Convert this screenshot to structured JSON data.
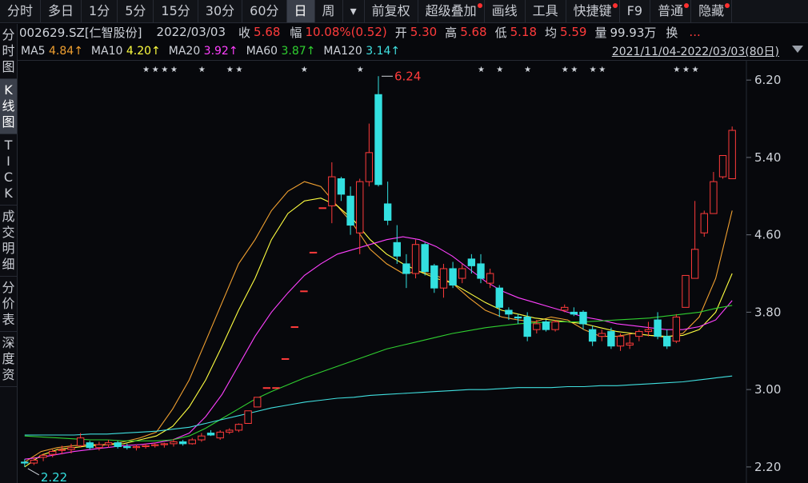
{
  "toolbar": {
    "items": [
      "分时",
      "多日",
      "1分",
      "5分",
      "15分",
      "30分",
      "60分",
      "日",
      "周",
      "▾",
      "前复权",
      "超级叠加",
      "画线",
      "工具",
      "快捷键",
      "F9",
      "普通",
      "隐藏"
    ],
    "active_index": 7,
    "dot_indices": [
      11,
      14,
      16,
      17
    ]
  },
  "sidebar": {
    "items": [
      "分时图",
      "K线图",
      "TICK",
      "成交明细",
      "分价表",
      "深度资"
    ],
    "active_index": 1
  },
  "quote": {
    "code": "002629.SZ[仁智股份]",
    "date": "2022/03/03",
    "close_label": "收",
    "close": "5.68",
    "change_label": "幅",
    "change": "10.08%(0.52)",
    "open_label": "开",
    "open": "5.30",
    "high_label": "高",
    "high": "5.68",
    "low_label": "低",
    "low": "5.18",
    "avg_label": "均",
    "avg": "5.59",
    "vol_label": "量",
    "vol": "99.93万",
    "turn_label": "换",
    "more": "..."
  },
  "ma_bar": [
    {
      "name": "MA5",
      "value": "4.84↑",
      "color": "#f0a030"
    },
    {
      "name": "MA10",
      "value": "4.20↑",
      "color": "#ffff40"
    },
    {
      "name": "MA20",
      "value": "3.92↑",
      "color": "#ff40ff"
    },
    {
      "name": "MA60",
      "value": "3.87↑",
      "color": "#30d030"
    },
    {
      "name": "MA120",
      "value": "3.14↑",
      "color": "#40e0e0"
    }
  ],
  "range_label": "2021/11/04-2022/03/03(80日)",
  "chart_data": {
    "type": "candlestick",
    "y_ticks": [
      "6.20",
      "5.40",
      "4.60",
      "3.80",
      "3.00",
      "2.20"
    ],
    "ylim": [
      2.1,
      6.35
    ],
    "annotations": {
      "high_value": "6.24",
      "low_value": "2.22"
    },
    "candles": [
      [
        2.25,
        2.28,
        2.2,
        2.24
      ],
      [
        2.24,
        2.3,
        2.22,
        2.27
      ],
      [
        2.3,
        2.34,
        2.26,
        2.32
      ],
      [
        2.33,
        2.38,
        2.3,
        2.36
      ],
      [
        2.37,
        2.42,
        2.33,
        2.38
      ],
      [
        2.38,
        2.44,
        2.34,
        2.4
      ],
      [
        2.42,
        2.55,
        2.4,
        2.5
      ],
      [
        2.45,
        2.47,
        2.38,
        2.4
      ],
      [
        2.4,
        2.46,
        2.37,
        2.43
      ],
      [
        2.43,
        2.48,
        2.4,
        2.45
      ],
      [
        2.45,
        2.47,
        2.39,
        2.41
      ],
      [
        2.41,
        2.44,
        2.38,
        2.4
      ],
      [
        2.4,
        2.43,
        2.37,
        2.41
      ],
      [
        2.41,
        2.44,
        2.39,
        2.42
      ],
      [
        2.42,
        2.45,
        2.4,
        2.43
      ],
      [
        2.43,
        2.45,
        2.4,
        2.44
      ],
      [
        2.44,
        2.49,
        2.41,
        2.46
      ],
      [
        2.46,
        2.48,
        2.42,
        2.44
      ],
      [
        2.44,
        2.5,
        2.43,
        2.48
      ],
      [
        2.48,
        2.55,
        2.46,
        2.52
      ],
      [
        2.55,
        2.58,
        2.52,
        2.53
      ],
      [
        2.5,
        2.58,
        2.48,
        2.56
      ],
      [
        2.56,
        2.6,
        2.54,
        2.58
      ],
      [
        2.58,
        2.65,
        2.56,
        2.64
      ],
      [
        2.65,
        2.78,
        2.65,
        2.78
      ],
      [
        2.82,
        2.92,
        2.82,
        2.92
      ],
      [
        3.02,
        3.02,
        3.02,
        3.02
      ],
      [
        3.02,
        3.02,
        3.02,
        3.02
      ],
      [
        3.32,
        3.32,
        3.32,
        3.32
      ],
      [
        3.65,
        3.65,
        3.65,
        3.65
      ],
      [
        4.02,
        4.02,
        4.02,
        4.02
      ],
      [
        4.42,
        4.42,
        4.42,
        4.42
      ],
      [
        4.88,
        4.88,
        4.88,
        4.88
      ],
      [
        4.9,
        5.35,
        4.72,
        5.2
      ],
      [
        5.18,
        5.2,
        4.95,
        5.02
      ],
      [
        5.0,
        5.1,
        4.6,
        4.7
      ],
      [
        4.62,
        5.18,
        4.4,
        5.15
      ],
      [
        5.15,
        5.75,
        5.1,
        5.45
      ],
      [
        6.05,
        6.24,
        5.1,
        5.12
      ],
      [
        4.92,
        5.15,
        4.7,
        4.75
      ],
      [
        4.52,
        4.7,
        4.3,
        4.38
      ],
      [
        4.3,
        4.4,
        4.05,
        4.2
      ],
      [
        4.2,
        4.55,
        4.15,
        4.5
      ],
      [
        4.5,
        4.52,
        4.18,
        4.22
      ],
      [
        4.28,
        4.3,
        4.0,
        4.05
      ],
      [
        4.05,
        4.3,
        3.95,
        4.25
      ],
      [
        4.25,
        4.32,
        4.05,
        4.08
      ],
      [
        4.15,
        4.3,
        4.1,
        4.25
      ],
      [
        4.35,
        4.4,
        4.2,
        4.28
      ],
      [
        4.3,
        4.4,
        4.1,
        4.15
      ],
      [
        4.1,
        4.25,
        4.05,
        4.2
      ],
      [
        4.05,
        4.08,
        3.75,
        3.85
      ],
      [
        3.82,
        3.85,
        3.72,
        3.78
      ],
      [
        3.75,
        3.78,
        3.68,
        3.74
      ],
      [
        3.75,
        3.8,
        3.5,
        3.55
      ],
      [
        3.62,
        3.72,
        3.58,
        3.68
      ],
      [
        3.7,
        3.72,
        3.6,
        3.62
      ],
      [
        3.62,
        3.72,
        3.6,
        3.7
      ],
      [
        3.82,
        3.88,
        3.8,
        3.85
      ],
      [
        3.8,
        3.85,
        3.76,
        3.78
      ],
      [
        3.8,
        3.82,
        3.62,
        3.68
      ],
      [
        3.62,
        3.66,
        3.45,
        3.5
      ],
      [
        3.55,
        3.62,
        3.5,
        3.58
      ],
      [
        3.6,
        3.64,
        3.42,
        3.45
      ],
      [
        3.45,
        3.58,
        3.4,
        3.55
      ],
      [
        3.46,
        3.58,
        3.42,
        3.48
      ],
      [
        3.55,
        3.62,
        3.5,
        3.6
      ],
      [
        3.6,
        3.7,
        3.55,
        3.62
      ],
      [
        3.72,
        3.8,
        3.52,
        3.55
      ],
      [
        3.55,
        3.62,
        3.42,
        3.45
      ],
      [
        3.5,
        3.78,
        3.48,
        3.75
      ],
      [
        3.85,
        4.18,
        3.85,
        4.18
      ],
      [
        4.15,
        4.95,
        4.15,
        4.45
      ],
      [
        4.62,
        4.85,
        4.58,
        4.82
      ],
      [
        4.82,
        5.25,
        4.82,
        5.15
      ],
      [
        5.2,
        5.42,
        5.18,
        5.42
      ],
      [
        5.18,
        5.72,
        5.18,
        5.68
      ]
    ],
    "ma": {
      "MA5": [
        [
          2.25,
          2.36
        ],
        [
          2.4,
          2.42
        ],
        [
          2.43,
          2.43
        ],
        [
          2.46,
          2.5
        ],
        [
          2.56,
          2.8
        ],
        [
          3.1,
          3.5
        ],
        [
          3.9,
          4.3
        ],
        [
          4.55,
          4.85
        ],
        [
          5.05,
          5.15
        ],
        [
          5.1,
          4.9
        ],
        [
          4.7,
          4.45
        ],
        [
          4.3,
          4.2
        ],
        [
          4.22,
          4.18
        ],
        [
          4.1,
          3.95
        ],
        [
          3.82,
          3.75
        ],
        [
          3.72,
          3.7
        ],
        [
          3.75,
          3.72
        ],
        [
          3.62,
          3.55
        ],
        [
          3.55,
          3.58
        ],
        [
          3.56,
          3.54
        ],
        [
          3.58,
          3.75
        ],
        [
          4.15,
          4.85
        ]
      ],
      "MA10": [
        [
          2.2,
          2.32
        ],
        [
          2.38,
          2.4
        ],
        [
          2.42,
          2.43
        ],
        [
          2.44,
          2.48
        ],
        [
          2.52,
          2.62
        ],
        [
          2.82,
          3.1
        ],
        [
          3.45,
          3.82
        ],
        [
          4.15,
          4.55
        ],
        [
          4.82,
          4.95
        ],
        [
          4.98,
          4.9
        ],
        [
          4.75,
          4.55
        ],
        [
          4.4,
          4.3
        ],
        [
          4.22,
          4.15
        ],
        [
          4.1,
          4.0
        ],
        [
          3.9,
          3.82
        ],
        [
          3.78,
          3.74
        ],
        [
          3.72,
          3.7
        ],
        [
          3.68,
          3.64
        ],
        [
          3.6,
          3.58
        ],
        [
          3.56,
          3.55
        ],
        [
          3.56,
          3.62
        ],
        [
          3.8,
          4.2
        ]
      ],
      "MA20": [
        [
          2.28,
          2.3
        ],
        [
          2.33,
          2.36
        ],
        [
          2.38,
          2.4
        ],
        [
          2.42,
          2.43
        ],
        [
          2.45,
          2.48
        ],
        [
          2.55,
          2.72
        ],
        [
          2.95,
          3.25
        ],
        [
          3.55,
          3.8
        ],
        [
          4.0,
          4.18
        ],
        [
          4.3,
          4.4
        ],
        [
          4.45,
          4.5
        ],
        [
          4.55,
          4.58
        ],
        [
          4.55,
          4.48
        ],
        [
          4.38,
          4.25
        ],
        [
          4.12,
          4.02
        ],
        [
          3.95,
          3.9
        ],
        [
          3.85,
          3.8
        ],
        [
          3.75,
          3.72
        ],
        [
          3.68,
          3.66
        ],
        [
          3.64,
          3.62
        ],
        [
          3.62,
          3.65
        ],
        [
          3.72,
          3.92
        ]
      ],
      "MA60": [
        [
          2.52,
          2.51
        ],
        [
          2.5,
          2.49
        ],
        [
          2.48,
          2.48
        ],
        [
          2.47,
          2.47
        ],
        [
          2.47,
          2.48
        ],
        [
          2.52,
          2.6
        ],
        [
          2.7,
          2.8
        ],
        [
          2.9,
          2.98
        ],
        [
          3.05,
          3.12
        ],
        [
          3.18,
          3.24
        ],
        [
          3.3,
          3.36
        ],
        [
          3.42,
          3.46
        ],
        [
          3.5,
          3.54
        ],
        [
          3.58,
          3.61
        ],
        [
          3.64,
          3.66
        ],
        [
          3.68,
          3.69
        ],
        [
          3.7,
          3.7
        ],
        [
          3.7,
          3.71
        ],
        [
          3.72,
          3.73
        ],
        [
          3.74,
          3.76
        ],
        [
          3.78,
          3.8
        ],
        [
          3.84,
          3.87
        ]
      ],
      "MA120": [
        [
          2.53,
          2.53
        ],
        [
          2.53,
          2.53
        ],
        [
          2.54,
          2.54
        ],
        [
          2.55,
          2.56
        ],
        [
          2.57,
          2.59
        ],
        [
          2.61,
          2.65
        ],
        [
          2.69,
          2.73
        ],
        [
          2.77,
          2.81
        ],
        [
          2.84,
          2.87
        ],
        [
          2.89,
          2.91
        ],
        [
          2.92,
          2.94
        ],
        [
          2.95,
          2.96
        ],
        [
          2.97,
          2.98
        ],
        [
          2.99,
          3.0
        ],
        [
          3.0,
          3.01
        ],
        [
          3.02,
          3.02
        ],
        [
          3.02,
          3.03
        ],
        [
          3.03,
          3.04
        ],
        [
          3.04,
          3.05
        ],
        [
          3.06,
          3.07
        ],
        [
          3.08,
          3.1
        ],
        [
          3.12,
          3.14
        ]
      ]
    },
    "stars_at": [
      13,
      14,
      15,
      16,
      19,
      22,
      23,
      30,
      36,
      49,
      51,
      54,
      58,
      59,
      61,
      62,
      70,
      71,
      72
    ],
    "stars_label": "★"
  }
}
